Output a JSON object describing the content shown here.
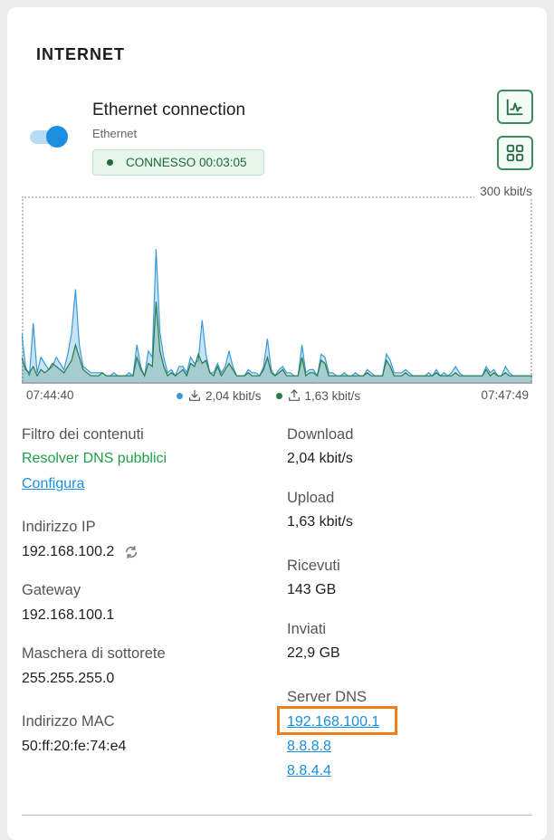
{
  "section_title": "INTERNET",
  "connection": {
    "enabled": true,
    "name": "Ethernet connection",
    "type": "Ethernet",
    "status": "CONNESSO 00:03:05"
  },
  "chart_data": {
    "type": "area",
    "title": "",
    "ymax_label": "300 kbit/s",
    "ylim": [
      0,
      300
    ],
    "x_start": "07:44:40",
    "x_end": "07:47:49",
    "series": [
      {
        "name": "2,04 kbit/s",
        "color": "#3a9ad9",
        "values": [
          80,
          25,
          10,
          95,
          15,
          40,
          30,
          20,
          25,
          40,
          30,
          20,
          45,
          80,
          150,
          60,
          25,
          20,
          15,
          15,
          15,
          15,
          10,
          10,
          15,
          10,
          10,
          10,
          15,
          10,
          60,
          25,
          10,
          50,
          40,
          215,
          80,
          40,
          15,
          20,
          10,
          25,
          25,
          15,
          40,
          30,
          35,
          100,
          45,
          15,
          15,
          30,
          15,
          25,
          50,
          25,
          10,
          10,
          10,
          20,
          15,
          15,
          10,
          25,
          70,
          20,
          10,
          20,
          25,
          15,
          15,
          10,
          10,
          60,
          15,
          20,
          20,
          10,
          45,
          40,
          15,
          15,
          10,
          10,
          15,
          10,
          10,
          15,
          10,
          10,
          20,
          15,
          10,
          10,
          10,
          45,
          35,
          15,
          15,
          15,
          20,
          15,
          10,
          10,
          10,
          10,
          15,
          10,
          20,
          10,
          15,
          10,
          15,
          25,
          15,
          10,
          10,
          10,
          10,
          10,
          10,
          25,
          15,
          20,
          10,
          10,
          25,
          15,
          10,
          10,
          10,
          10,
          10,
          10
        ]
      },
      {
        "name": "1,63 kbit/s",
        "color": "#2b7a47",
        "values": [
          40,
          20,
          15,
          25,
          10,
          20,
          15,
          20,
          30,
          25,
          20,
          15,
          25,
          35,
          60,
          40,
          20,
          15,
          10,
          10,
          10,
          15,
          10,
          10,
          10,
          10,
          10,
          10,
          10,
          10,
          40,
          20,
          10,
          30,
          25,
          130,
          50,
          25,
          10,
          15,
          10,
          15,
          20,
          10,
          30,
          25,
          45,
          30,
          35,
          15,
          10,
          25,
          10,
          20,
          30,
          20,
          10,
          10,
          10,
          15,
          10,
          10,
          10,
          20,
          40,
          15,
          10,
          15,
          20,
          10,
          10,
          10,
          10,
          40,
          10,
          15,
          15,
          10,
          35,
          30,
          10,
          10,
          10,
          10,
          10,
          10,
          10,
          10,
          10,
          10,
          15,
          10,
          10,
          10,
          10,
          35,
          25,
          10,
          10,
          10,
          15,
          10,
          10,
          10,
          10,
          10,
          10,
          10,
          15,
          10,
          10,
          10,
          10,
          15,
          10,
          10,
          10,
          10,
          10,
          10,
          10,
          20,
          10,
          15,
          10,
          10,
          15,
          10,
          10,
          10,
          10,
          10,
          10,
          10
        ]
      }
    ]
  },
  "info_left": {
    "filter_label": "Filtro dei contenuti",
    "filter_value": "Resolver DNS pubblici",
    "configure_link": "Configura",
    "ip_label": "Indirizzo IP",
    "ip_value": "192.168.100.2",
    "gateway_label": "Gateway",
    "gateway_value": "192.168.100.1",
    "mask_label": "Maschera di sottorete",
    "mask_value": "255.255.255.0",
    "mac_label": "Indirizzo MAC",
    "mac_value": "50:ff:20:fe:74:e4"
  },
  "info_right": {
    "download_label": "Download",
    "download_value": "2,04 kbit/s",
    "upload_label": "Upload",
    "upload_value": "1,63 kbit/s",
    "received_label": "Ricevuti",
    "received_value": "143 GB",
    "sent_label": "Inviati",
    "sent_value": "22,9 GB",
    "dns_label": "Server DNS",
    "dns_servers": [
      "192.168.100.1",
      "8.8.8.8",
      "8.8.4.4"
    ]
  },
  "icons": {
    "chart_button": "line-chart-icon",
    "grid_button": "grid-icon",
    "download": "download-icon",
    "upload": "upload-icon",
    "refresh": "refresh-icon"
  },
  "colors": {
    "accent_blue": "#1a8fe0",
    "success_green": "#1f9e4a",
    "highlight_orange": "#f07f1a"
  }
}
